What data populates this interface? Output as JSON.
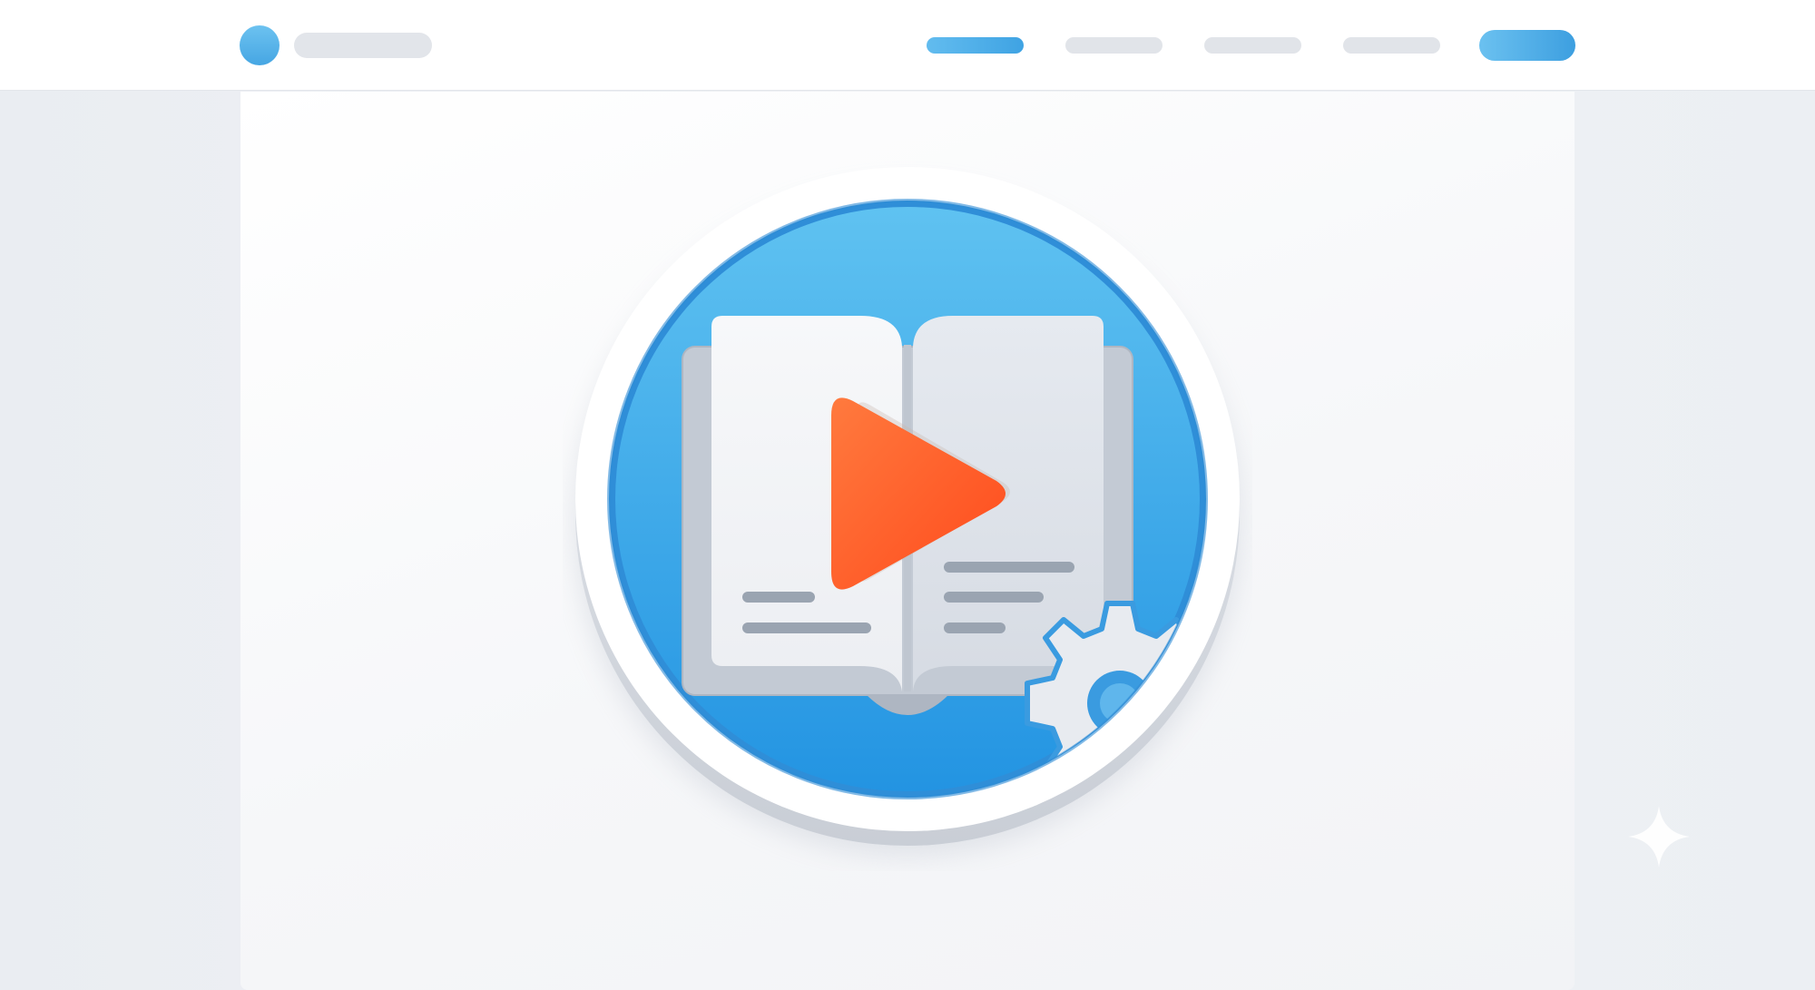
{
  "header": {
    "logo": {
      "icon": "logo-dot-icon"
    },
    "nav": [
      {
        "id": "nav-item-1",
        "active": true
      },
      {
        "id": "nav-item-2",
        "active": false
      },
      {
        "id": "nav-item-3",
        "active": false
      },
      {
        "id": "nav-item-4",
        "active": false
      }
    ],
    "cta": {
      "id": "nav-cta-button"
    }
  },
  "hero": {
    "icon": "video-manual-icon",
    "parts": [
      "book-icon",
      "play-icon",
      "gear-icon"
    ]
  },
  "decor": {
    "icon": "sparkle-icon"
  },
  "colors": {
    "accent_blue": "#3fa3e3",
    "light_blue": "#6cc2f0",
    "play_orange": "#ff5a2a",
    "placeholder_gray": "#e1e4e9",
    "page_background": "#eceff3"
  }
}
